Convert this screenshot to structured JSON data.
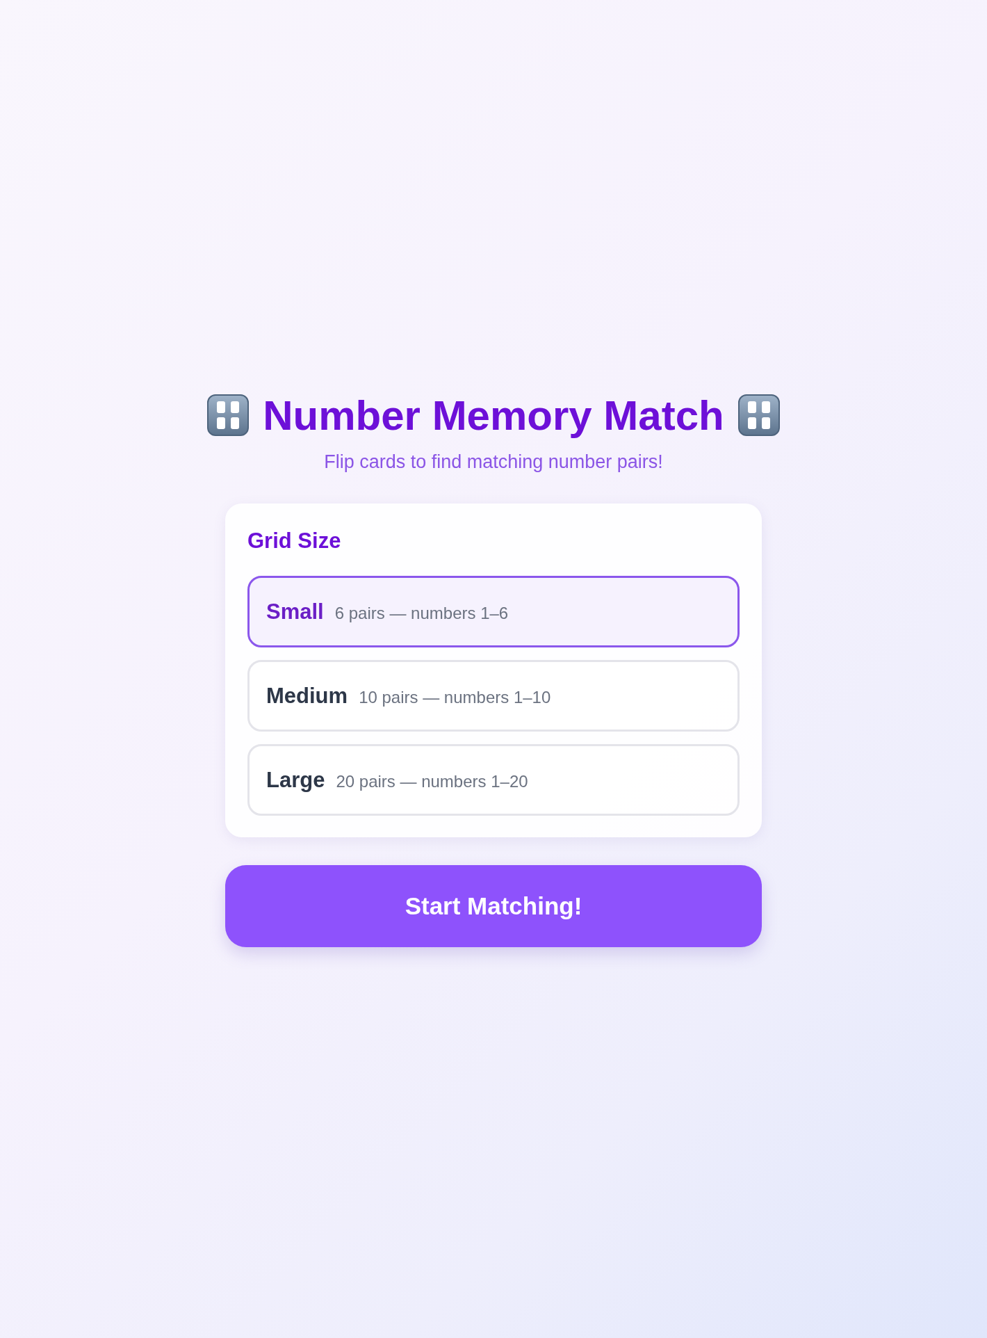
{
  "header": {
    "title": "Number Memory Match",
    "subtitle": "Flip cards to find matching number pairs!"
  },
  "grid_size": {
    "heading": "Grid Size",
    "options": [
      {
        "label": "Small",
        "description": "6 pairs — numbers 1–6",
        "selected": true
      },
      {
        "label": "Medium",
        "description": "10 pairs — numbers 1–10",
        "selected": false
      },
      {
        "label": "Large",
        "description": "20 pairs — numbers 1–20",
        "selected": false
      }
    ]
  },
  "start_button": {
    "label": "Start Matching!"
  }
}
